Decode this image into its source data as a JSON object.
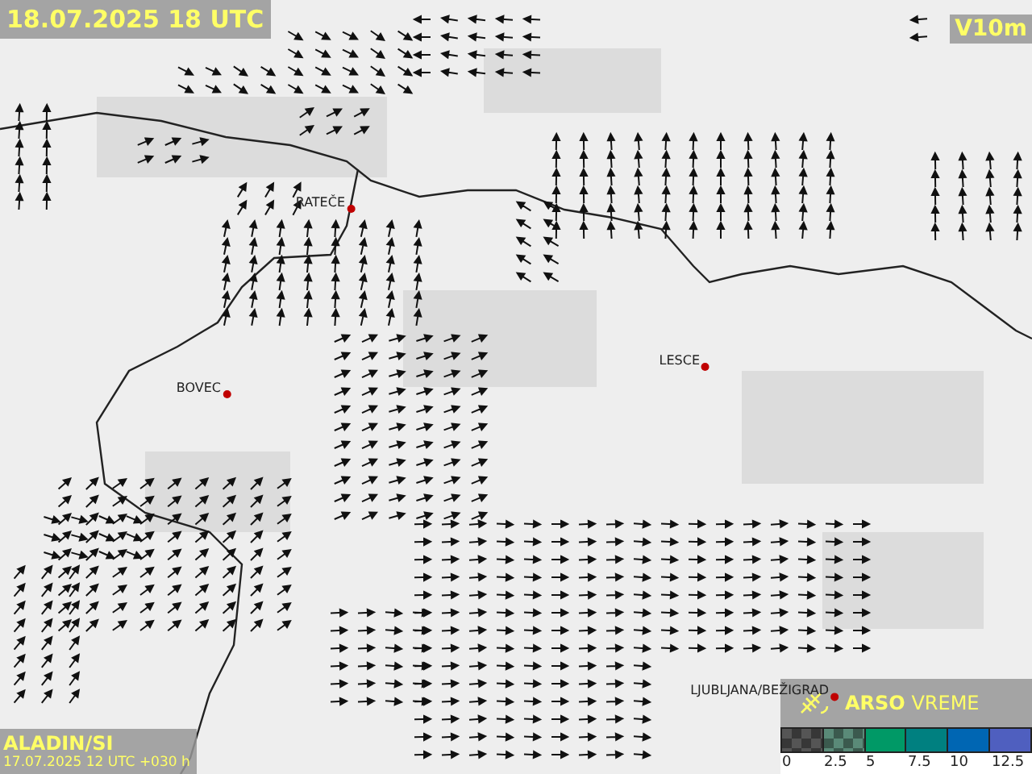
{
  "header": {
    "valid_time": "18.07.2025 18 UTC",
    "variable": "V10m"
  },
  "cities": [
    {
      "name": "RATEČE"
    },
    {
      "name": "BOVEC"
    },
    {
      "name": "LESCE"
    },
    {
      "name": "LJUBLJANA/BEŽIGRAD"
    }
  ],
  "footer": {
    "model": "ALADIN/SI",
    "run": "17.07.2025 12 UTC +030 h"
  },
  "logo": {
    "text": "**ARSO** VREME"
  },
  "legend": {
    "swatches": [
      {
        "kind": "checker",
        "color": "#555555"
      },
      {
        "kind": "checker",
        "color": "#5a8a78"
      },
      {
        "kind": "solid",
        "color": "#009966"
      },
      {
        "kind": "solid",
        "color": "#008080"
      },
      {
        "kind": "solid",
        "color": "#0066b3"
      },
      {
        "kind": "solid",
        "color": "#4f5fbf"
      }
    ],
    "labels": [
      "0",
      "2.5",
      "5",
      "7.5",
      "10",
      "12.5"
    ]
  }
}
